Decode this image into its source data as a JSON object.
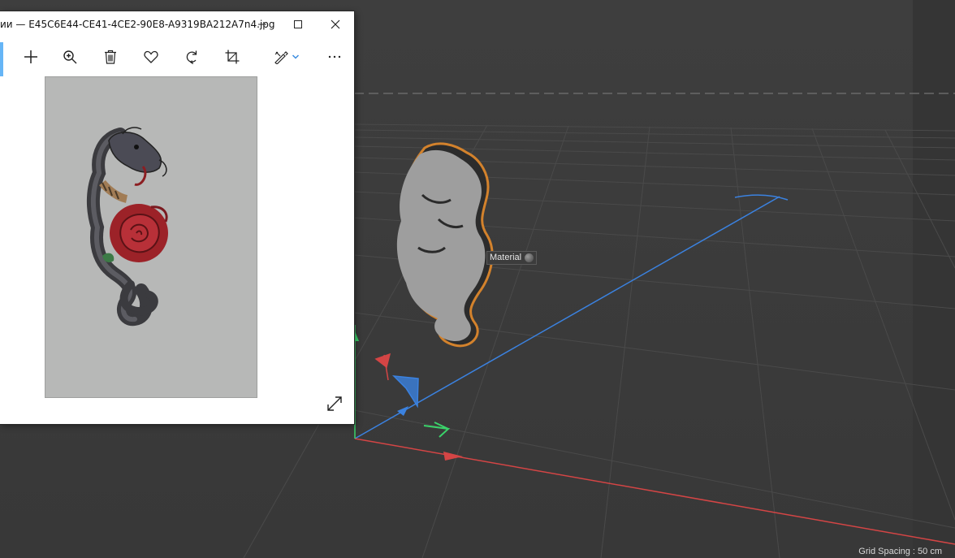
{
  "viewer": {
    "title": "ии — E45C6E44-CE41-4CE2-90E8-A9319BA212A7n4.jpg",
    "toolbar": {
      "add": "add-icon",
      "zoom": "zoom-in-icon",
      "delete": "trash-icon",
      "favorite": "heart-icon",
      "rotate": "rotate-icon",
      "crop": "crop-icon",
      "edit": "edit-draw-icon",
      "more": "more-icon"
    },
    "accent_color": "#66b5f6"
  },
  "viewport": {
    "material_label": "Material",
    "grid_spacing": "Grid Spacing : 50 cm",
    "axis_colors": {
      "x": "#e04646",
      "y": "#3ad36a",
      "z": "#3b82e0"
    },
    "selection_color": "#d3822c"
  }
}
